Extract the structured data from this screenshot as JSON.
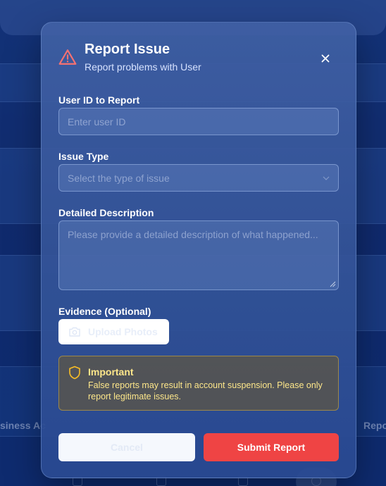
{
  "background": {
    "left_label": "siness Ac",
    "right_label": "Repo"
  },
  "modal": {
    "title": "Report Issue",
    "subtitle": "Report problems with User",
    "header_icon": "warning-triangle-icon",
    "close_icon": "close-icon"
  },
  "form": {
    "user_id": {
      "label": "User ID to Report",
      "placeholder": "Enter user ID",
      "value": ""
    },
    "issue_type": {
      "label": "Issue Type",
      "placeholder": "Select the type of issue",
      "icon": "chevron-down-icon"
    },
    "description": {
      "label": "Detailed Description",
      "placeholder": "Please provide a detailed description of what happened...",
      "value": ""
    },
    "evidence": {
      "label": "Evidence (Optional)",
      "button_label": "Upload Photos",
      "icon": "camera-icon"
    }
  },
  "notice": {
    "icon": "shield-icon",
    "title": "Important",
    "text": "False reports may result in account suspension. Please only report legitimate issues."
  },
  "actions": {
    "cancel_label": "Cancel",
    "submit_label": "Submit Report"
  },
  "colors": {
    "accent_red": "#ef4444",
    "warning_text": "#fde68a",
    "warning_border": "#b0963e"
  }
}
